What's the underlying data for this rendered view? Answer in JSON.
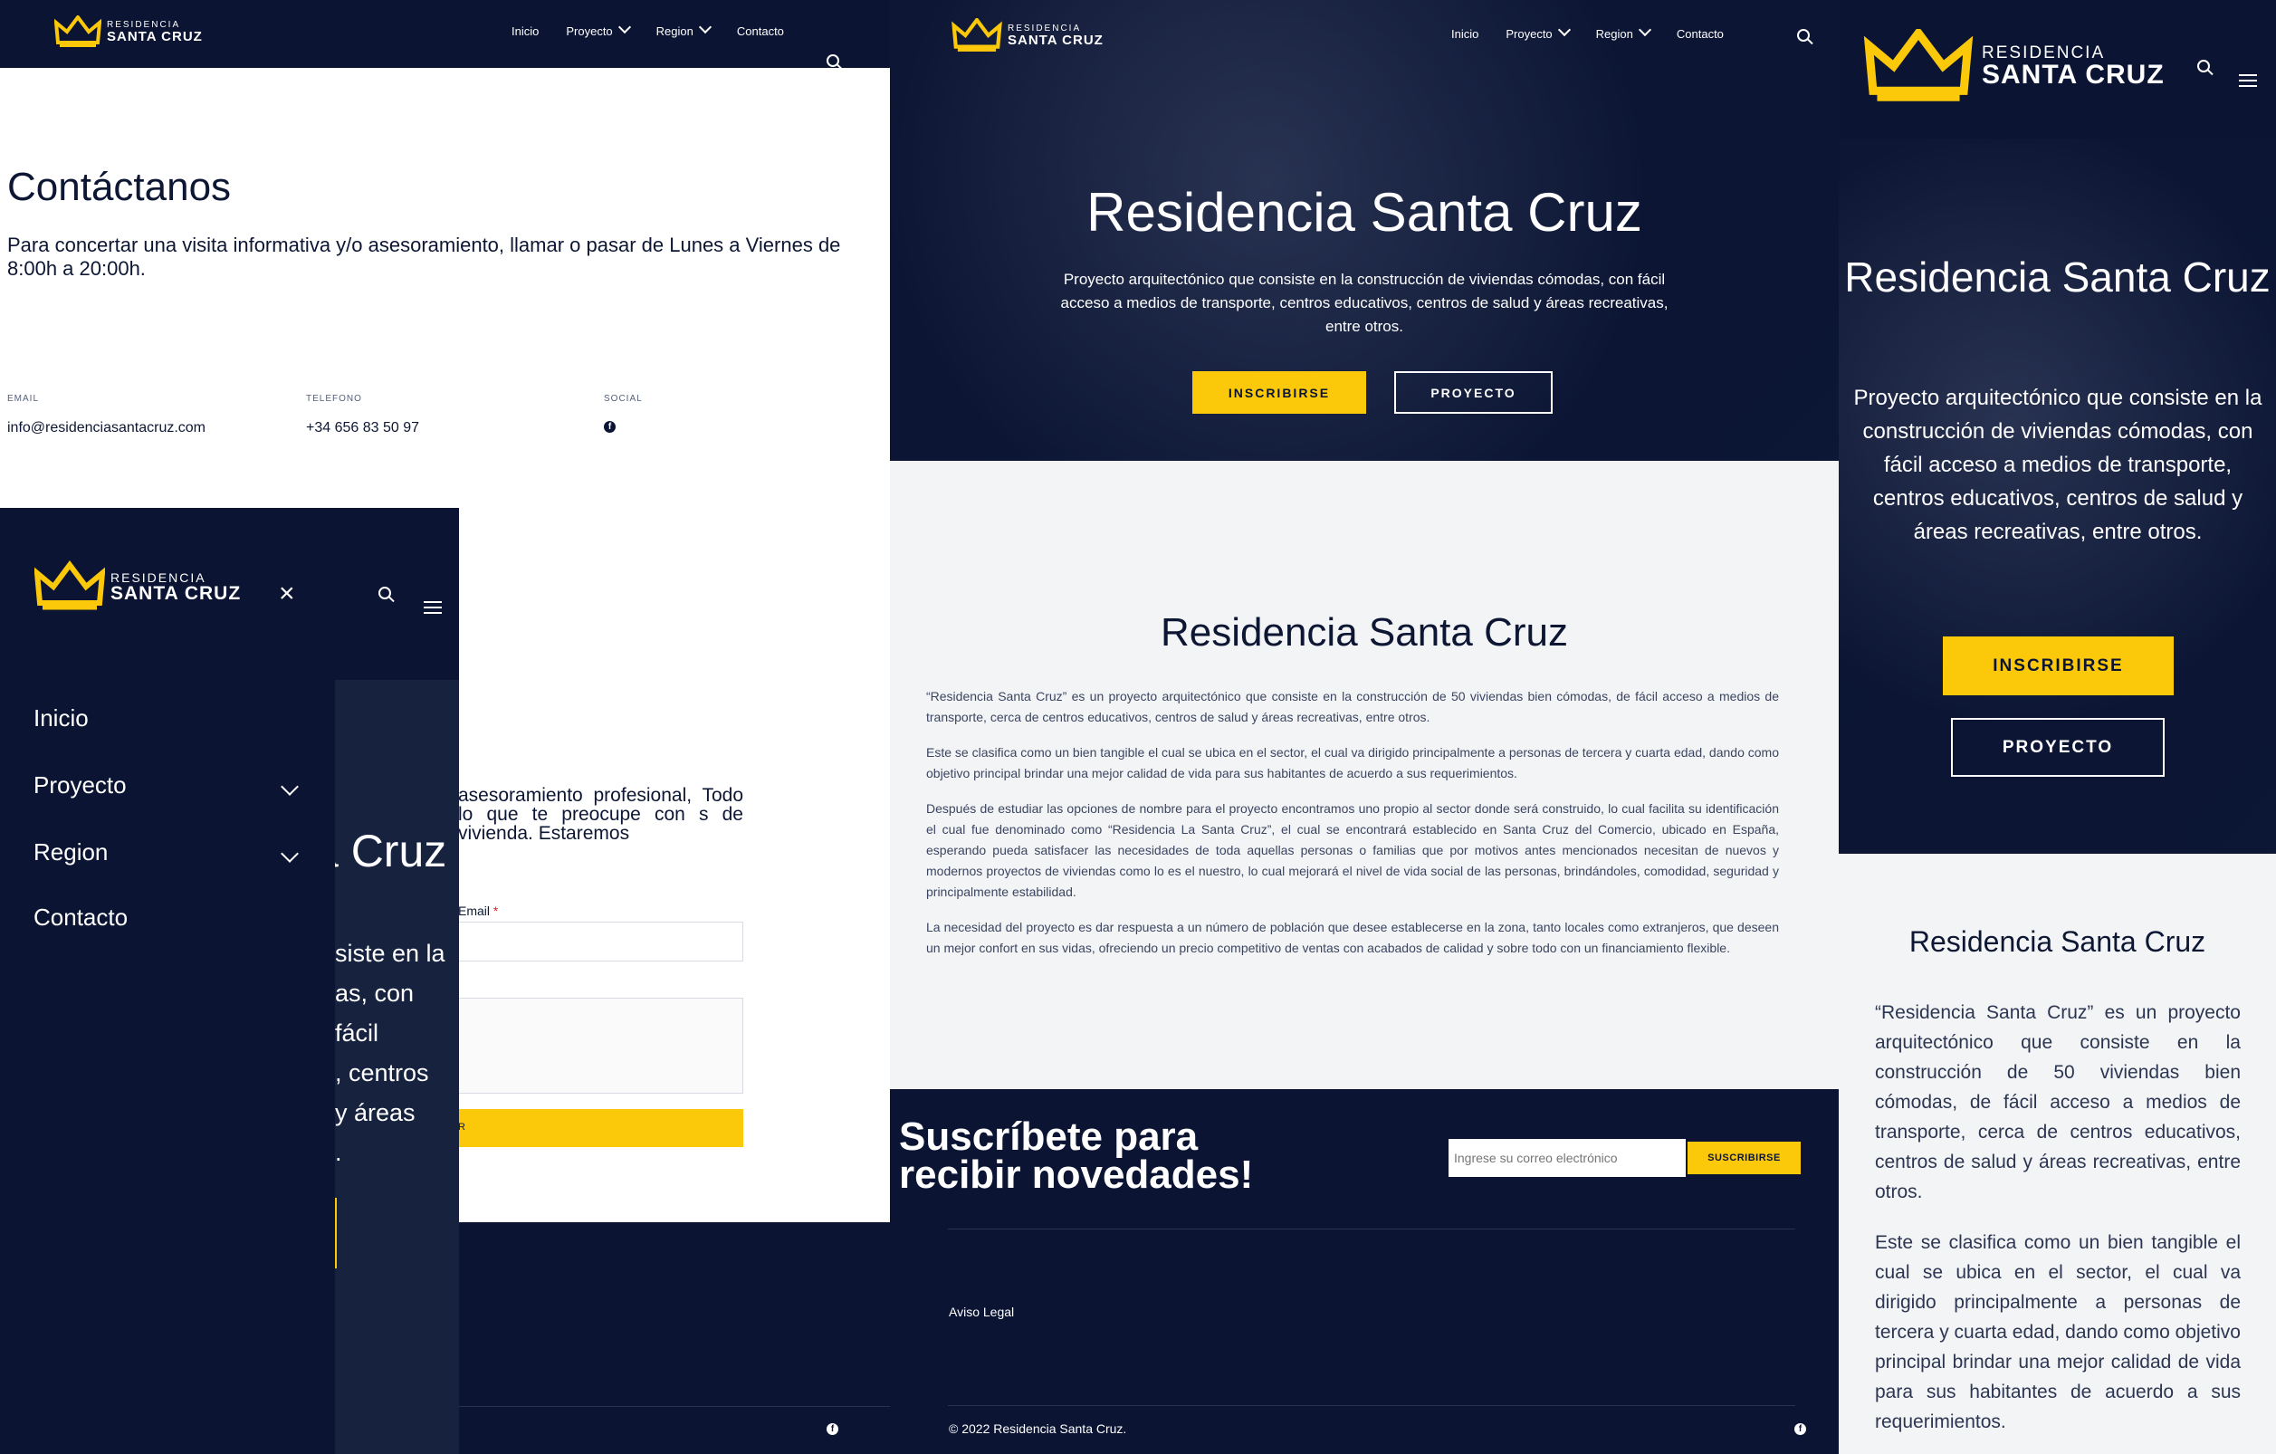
{
  "brand": {
    "small": "RESIDENCIA",
    "big": "SANTA CRUZ"
  },
  "nav": {
    "items": [
      "Inicio",
      "Proyecto",
      "Region",
      "Contacto"
    ]
  },
  "contact": {
    "title": "Contáctanos",
    "intro": "Para concertar una visita informativa y/o asesoramiento, llamar o pasar de Lunes a Viernes de 8:00h a 20:00h.",
    "email_label": "EMAIL",
    "email_value": "info@residenciasantacruz.com",
    "phone_label": "TELEFONO",
    "phone_value": "+34 656 83 50 97",
    "social_label": "SOCIAL",
    "partial_text": "asesoramiento profesional, Todo lo que te preocupe con s de vivienda. Estaremos",
    "form_email_label": "Email",
    "required_mark": "*",
    "submit_partial": "R"
  },
  "mobile_menu": {
    "items": [
      "Inicio",
      "Proyecto",
      "Region",
      "Contacto"
    ],
    "hero_title_fragment": "a Cruz",
    "hero_lines": [
      "siste en la",
      "as, con fácil",
      ", centros",
      "y áreas",
      "."
    ]
  },
  "hero": {
    "title": "Residencia Santa Cruz",
    "subtitle": "Proyecto arquitectónico que consiste en la construcción de viviendas cómodas, con fácil acceso a medios de transporte, centros educativos, centros de salud y áreas recreativas, entre otros.",
    "btn_primary": "INSCRIBIRSE",
    "btn_secondary": "PROYECTO"
  },
  "about": {
    "title": "Residencia Santa Cruz",
    "paragraphs": [
      "“Residencia Santa Cruz” es un proyecto arquitectónico que consiste en la construcción de 50 viviendas bien cómodas, de fácil acceso a medios de transporte, cerca de centros educativos, centros de salud y áreas recreativas, entre otros.",
      "Este se clasifica como un bien tangible el cual se ubica en el sector, el cual va dirigido principalmente a personas de tercera y cuarta edad, dando como objetivo principal brindar una mejor calidad de vida para sus habitantes de acuerdo a sus requerimientos.",
      "Después de estudiar las opciones de nombre para el proyecto encontramos uno propio al sector donde será construido, lo cual facilita su identificación el cual fue denominado como “Residencia La Santa Cruz”, el cual se encontrará establecido en Santa Cruz del Comercio, ubicado en España, esperando pueda satisfacer las necesidades de toda aquellas personas o familias que por motivos antes mencionados necesitan de nuevos y modernos proyectos de viviendas como lo es el nuestro, lo cual mejorará el nivel de vida social de las personas, brindándoles, comodidad, seguridad y principalmente estabilidad.",
      "La necesidad del proyecto es dar respuesta a un número de población que desee establecerse en la zona, tanto locales como extranjeros, que deseen un mejor confort en sus vidas, ofreciendo un precio competitivo de ventas con acabados de calidad y sobre todo con un financiamiento flexible."
    ]
  },
  "newsletter": {
    "title_line1": "Suscríbete para",
    "title_line2": "recibir novedades!",
    "placeholder": "Ingrese su correo electrónico",
    "button": "SUSCRIBIRSE"
  },
  "footer": {
    "legal": "Aviso Legal",
    "copyright": "© 2022 Residencia Santa Cruz."
  },
  "mobile": {
    "hero_title": "Residencia Santa Cruz",
    "hero_text": "Proyecto arquitectónico que consiste en la construcción de viviendas cómodas, con fácil acceso a medios de transporte, centros educativos, centros de salud y áreas recreativas, entre otros.",
    "btn_primary": "INSCRIBIRSE",
    "btn_secondary": "PROYECTO",
    "about_title": "Residencia Santa Cruz",
    "about_p1": "“Residencia Santa Cruz” es un proyecto arquitectónico que consiste en la construcción de 50 viviendas bien cómodas, de fácil acceso a medios de transporte, cerca de centros educativos, centros de salud y áreas recreativas, entre otros.",
    "about_p2": "Este se clasifica como un bien tangible el cual se ubica en el sector, el cual va dirigido principalmente a personas de tercera y cuarta edad, dando como objetivo principal brindar una mejor calidad de vida para sus habitantes de acuerdo a sus requerimientos."
  },
  "colors": {
    "navy": "#0b1533",
    "accent": "#fcc80a",
    "light_bg": "#f3f4f6"
  }
}
